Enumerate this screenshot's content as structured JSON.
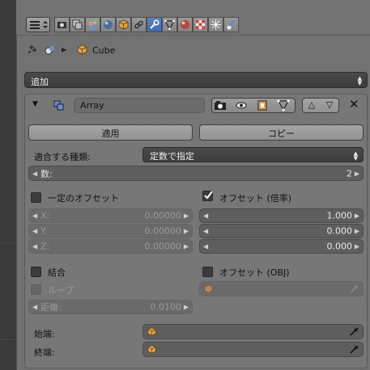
{
  "context_tabs": [
    "render",
    "render-layers",
    "scene",
    "world",
    "object",
    "constraints",
    "modifiers",
    "data",
    "material",
    "texture",
    "particles",
    "physics"
  ],
  "breadcrumb": {
    "object": "Cube"
  },
  "add_modifier": {
    "label": "追加"
  },
  "modifier": {
    "name": "Array",
    "apply_label": "適用",
    "copy_label": "コピー"
  },
  "fit_type": {
    "label": "適合する種類:",
    "value": "定数で指定"
  },
  "count": {
    "label": "数:",
    "value": "2"
  },
  "constant_offset": {
    "label": "一定のオフセット",
    "checked": false,
    "x_label": "X:",
    "x": "0.00000",
    "y_label": "Y:",
    "y": "0.00000",
    "z_label": "Z:",
    "z": "0.00000"
  },
  "relative_offset": {
    "label": "オフセット (倍率)",
    "checked": true,
    "x": "1.000",
    "y": "0.000",
    "z": "0.000"
  },
  "merge": {
    "label": "結合",
    "loop_label": "ループ",
    "distance_label": "距離:",
    "distance": "0.0100"
  },
  "object_offset": {
    "label": "オフセット (OBJ)",
    "value": ""
  },
  "start_cap": {
    "label": "始端:",
    "value": ""
  },
  "end_cap": {
    "label": "終端:",
    "value": ""
  },
  "colors": {
    "accent": "#5680c2",
    "panel": "#727272",
    "field": "#5e5e5e"
  }
}
